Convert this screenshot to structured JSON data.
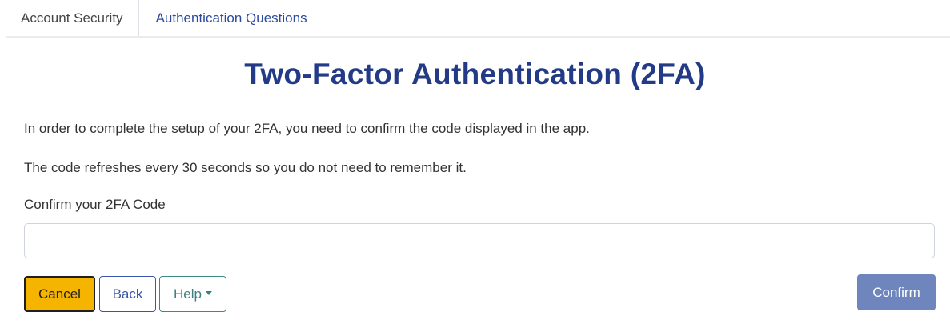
{
  "tabs": [
    {
      "label": "Account Security",
      "active": true
    },
    {
      "label": "Authentication Questions",
      "active": false
    }
  ],
  "page": {
    "title": "Two-Factor Authentication (2FA)",
    "paragraph1": "In order to complete the setup of your 2FA, you need to confirm the code displayed in the app.",
    "paragraph2": "The code refreshes every 30 seconds so you do not need to remember it."
  },
  "form": {
    "code_label": "Confirm your 2FA Code",
    "code_value": "",
    "code_placeholder": ""
  },
  "buttons": {
    "cancel": "Cancel",
    "back": "Back",
    "help": "Help",
    "confirm": "Confirm"
  },
  "colors": {
    "title": "#233a86",
    "tab_link": "#2b4a9e",
    "cancel_bg": "#f5b400",
    "confirm_bg": "#6f85bd",
    "back_border": "#3a56a8",
    "help_border": "#3b8a8a"
  },
  "icons": {
    "help_dropdown": "caret-down-icon"
  }
}
